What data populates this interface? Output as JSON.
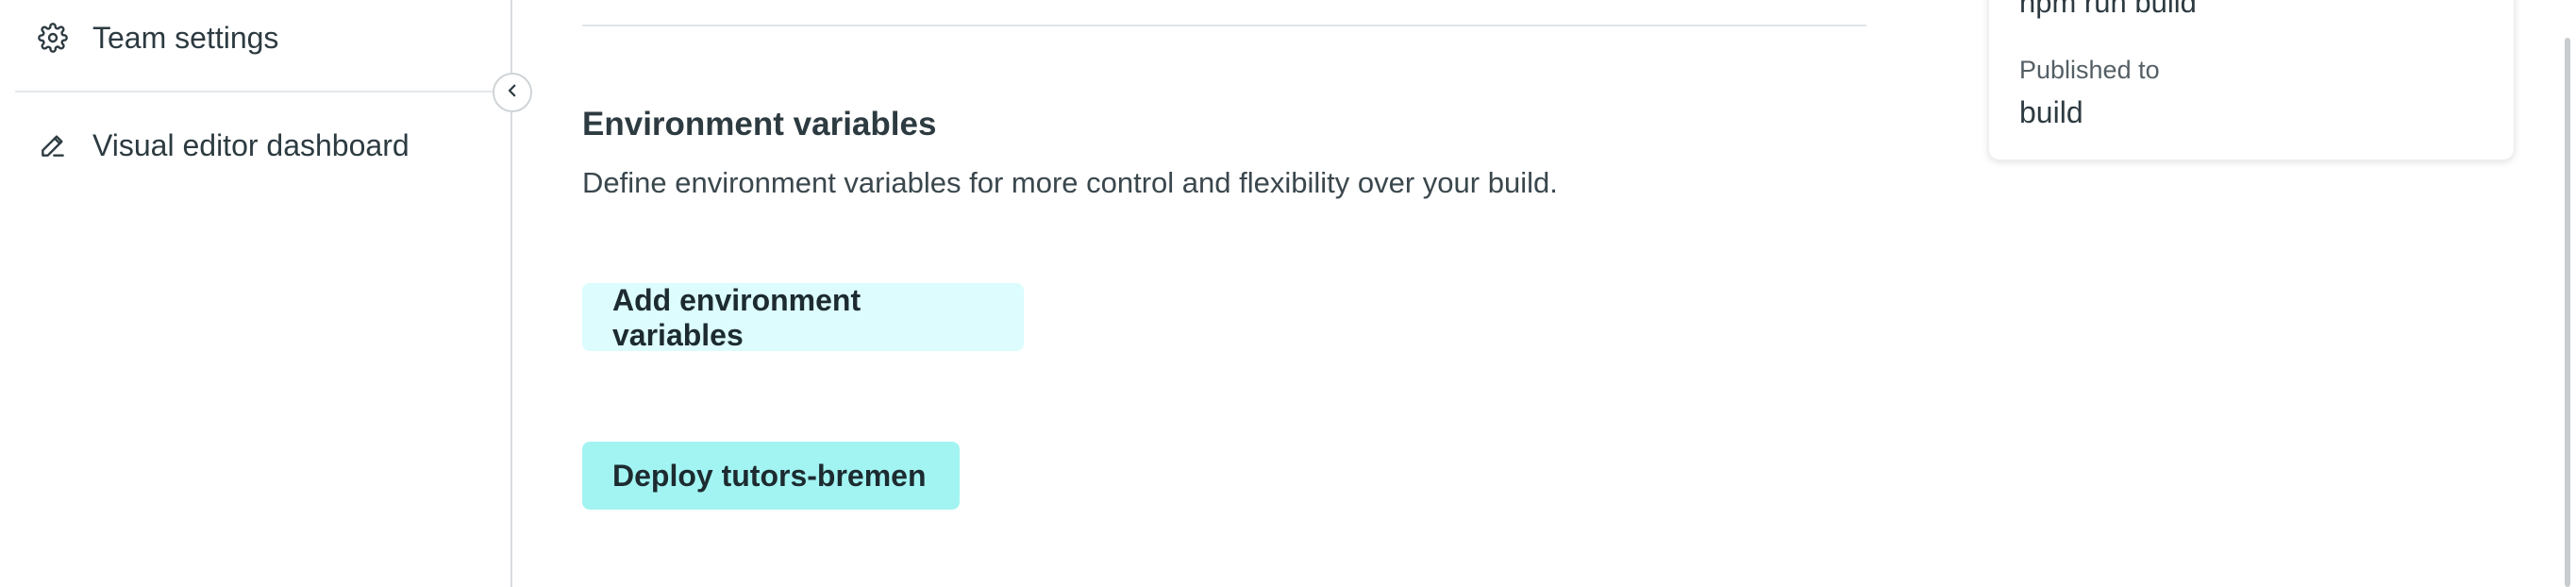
{
  "sidebar": {
    "items": [
      {
        "label": "Team settings",
        "icon": "gear-icon"
      },
      {
        "label": "Visual editor dashboard",
        "icon": "pencil-icon"
      }
    ],
    "collapse_icon": "chevron-left-icon"
  },
  "main": {
    "section_title": "Environment variables",
    "section_description": "Define environment variables for more control and flexibility over your build.",
    "add_env_button": "Add environment variables",
    "deploy_button": "Deploy tutors-bremen"
  },
  "card": {
    "build_command": "npm run build",
    "published_label": "Published to",
    "published_value": "build"
  },
  "colors": {
    "add_env_bg": "#dcfcfd",
    "deploy_bg": "#a2f4f2",
    "text": "#2d3b41"
  }
}
